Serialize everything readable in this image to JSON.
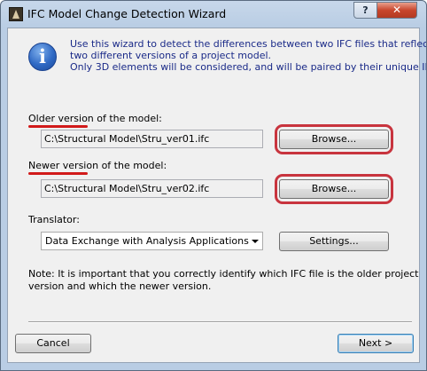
{
  "window": {
    "title": "IFC Model Change Detection Wizard",
    "help_label": "?",
    "close_label": "✕"
  },
  "intro": {
    "lines": [
      "Use this wizard to detect the differences between two IFC files that reflect",
      "two different versions of a project model.",
      "Only 3D elements will be considered, and will be paired by their unique ID."
    ]
  },
  "older": {
    "label": "Older version of the model:",
    "path": "C:\\Structural Model\\Stru_ver01.ifc",
    "browse_label": "Browse..."
  },
  "newer": {
    "label": "Newer version of the model:",
    "path": "C:\\Structural Model\\Stru_ver02.ifc",
    "browse_label": "Browse..."
  },
  "translator": {
    "label": "Translator:",
    "selected": "Data Exchange with Analysis Applications",
    "settings_label": "Settings..."
  },
  "note": {
    "lines": [
      "Note: It is important that you correctly identify which IFC file is the older project",
      "version and which the newer version."
    ]
  },
  "footer": {
    "cancel_label": "Cancel",
    "next_label": "Next >"
  },
  "colors": {
    "annotation_red": "#d11a1a",
    "info_blue": "#2f69c4",
    "intro_text": "#1a2a88"
  }
}
